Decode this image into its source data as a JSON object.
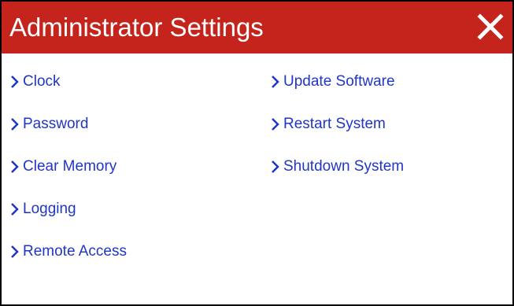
{
  "window": {
    "title": "Administrator Settings",
    "close_icon": "close-icon",
    "colors": {
      "titlebar": "#c4241c",
      "title_text": "#ffffff",
      "link": "#1f36c7",
      "border": "#000000"
    }
  },
  "menu": {
    "left": [
      {
        "label": "Clock",
        "icon": "chevron-right-icon"
      },
      {
        "label": "Password",
        "icon": "chevron-right-icon"
      },
      {
        "label": "Clear Memory",
        "icon": "chevron-right-icon"
      },
      {
        "label": "Logging",
        "icon": "chevron-right-icon"
      },
      {
        "label": "Remote Access",
        "icon": "chevron-right-icon"
      }
    ],
    "right": [
      {
        "label": "Update Software",
        "icon": "chevron-right-icon"
      },
      {
        "label": "Restart System",
        "icon": "chevron-right-icon"
      },
      {
        "label": "Shutdown System",
        "icon": "chevron-right-icon"
      }
    ]
  }
}
